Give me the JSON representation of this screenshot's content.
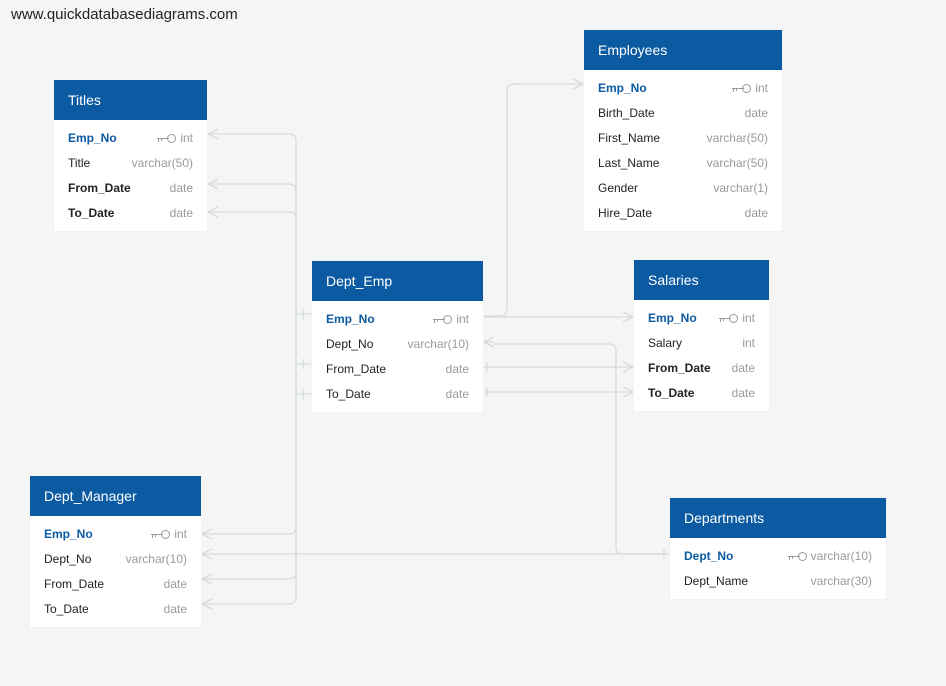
{
  "watermark": "www.quickdatabasediagrams.com",
  "colors": {
    "header": "#0b5aa2",
    "pk": "#0b5aa2",
    "type": "#9a9a9a",
    "wire": "#d7dadd"
  },
  "icons": {
    "primary_key": "key-icon"
  },
  "tables": {
    "titles": {
      "name": "Titles",
      "fields": [
        {
          "name": "Emp_No",
          "type": "int",
          "pk": true
        },
        {
          "name": "Title",
          "type": "varchar(50)"
        },
        {
          "name": "From_Date",
          "type": "date",
          "bold": true
        },
        {
          "name": "To_Date",
          "type": "date",
          "bold": true
        }
      ]
    },
    "employees": {
      "name": "Employees",
      "fields": [
        {
          "name": "Emp_No",
          "type": "int",
          "pk": true
        },
        {
          "name": "Birth_Date",
          "type": "date"
        },
        {
          "name": "First_Name",
          "type": "varchar(50)"
        },
        {
          "name": "Last_Name",
          "type": "varchar(50)"
        },
        {
          "name": "Gender",
          "type": "varchar(1)"
        },
        {
          "name": "Hire_Date",
          "type": "date"
        }
      ]
    },
    "dept_emp": {
      "name": "Dept_Emp",
      "fields": [
        {
          "name": "Emp_No",
          "type": "int",
          "pk": true
        },
        {
          "name": "Dept_No",
          "type": "varchar(10)"
        },
        {
          "name": "From_Date",
          "type": "date"
        },
        {
          "name": "To_Date",
          "type": "date"
        }
      ]
    },
    "salaries": {
      "name": "Salaries",
      "fields": [
        {
          "name": "Emp_No",
          "type": "int",
          "pk": true
        },
        {
          "name": "Salary",
          "type": "int"
        },
        {
          "name": "From_Date",
          "type": "date",
          "bold": true
        },
        {
          "name": "To_Date",
          "type": "date",
          "bold": true
        }
      ]
    },
    "dept_manager": {
      "name": "Dept_Manager",
      "fields": [
        {
          "name": "Emp_No",
          "type": "int",
          "pk": true
        },
        {
          "name": "Dept_No",
          "type": "varchar(10)"
        },
        {
          "name": "From_Date",
          "type": "date"
        },
        {
          "name": "To_Date",
          "type": "date"
        }
      ]
    },
    "departments": {
      "name": "Departments",
      "fields": [
        {
          "name": "Dept_No",
          "type": "varchar(10)",
          "pk": true
        },
        {
          "name": "Dept_Name",
          "type": "varchar(30)"
        }
      ]
    }
  }
}
